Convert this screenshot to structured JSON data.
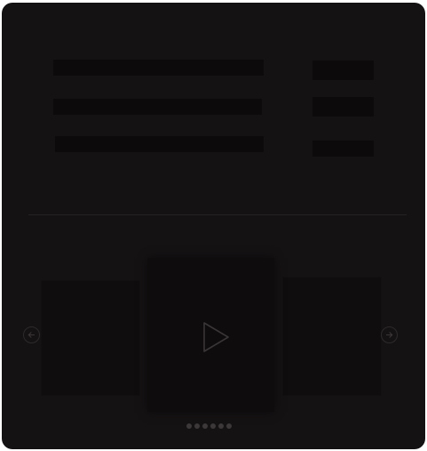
{
  "list": {
    "rows": [
      {
        "has_title": true,
        "has_meta": true
      },
      {
        "has_title": true,
        "has_meta": true
      },
      {
        "has_title": true,
        "has_meta": true
      }
    ]
  },
  "carousel": {
    "slide_count": 6,
    "active_index": 0,
    "prev_icon": "arrow-left-icon",
    "next_icon": "arrow-right-icon",
    "center_icon": "play-icon"
  },
  "colors": {
    "panel": "#151214",
    "skeleton": "#0c0a0b",
    "divider": "#262223",
    "icon_stroke": "#3a3638"
  }
}
